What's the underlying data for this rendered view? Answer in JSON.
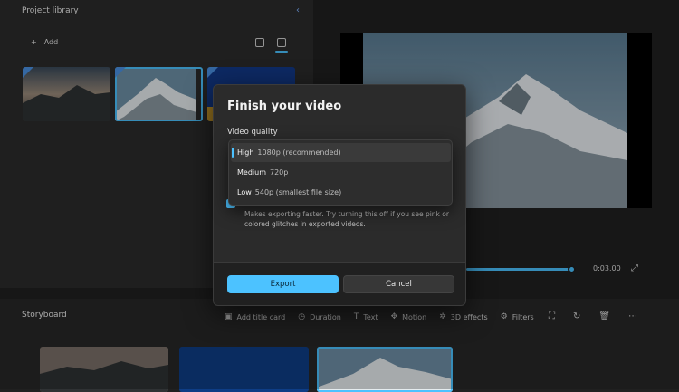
{
  "library": {
    "title": "Project library",
    "collapse_icon": "chevron-left",
    "add_label": "Add"
  },
  "preview": {
    "time": "0:03.00"
  },
  "storyboard": {
    "title": "Storyboard",
    "tools": [
      {
        "icon": "image-icon",
        "label": "Add title card"
      },
      {
        "icon": "clock-icon",
        "label": "Duration"
      },
      {
        "icon": "text-icon",
        "label": "Text"
      },
      {
        "icon": "motion-icon",
        "label": "Motion"
      },
      {
        "icon": "3d-icon",
        "label": "3D effects"
      },
      {
        "icon": "filters-icon",
        "label": "Filters"
      }
    ]
  },
  "dialog": {
    "title": "Finish your video",
    "quality_label": "Video quality",
    "options": [
      {
        "name": "High",
        "detail": "1080p (recommended)",
        "selected": true
      },
      {
        "name": "Medium",
        "detail": "720p",
        "selected": false
      },
      {
        "name": "Low",
        "detail": "540p (smallest file size)",
        "selected": false
      }
    ],
    "hint": "Makes exporting faster. Try turning this off if you see pink or colored glitches in exported videos.",
    "export_label": "Export",
    "cancel_label": "Cancel"
  },
  "colors": {
    "accent": "#4cc2ff",
    "panel": "#2b2b2b",
    "background": "#202020"
  }
}
